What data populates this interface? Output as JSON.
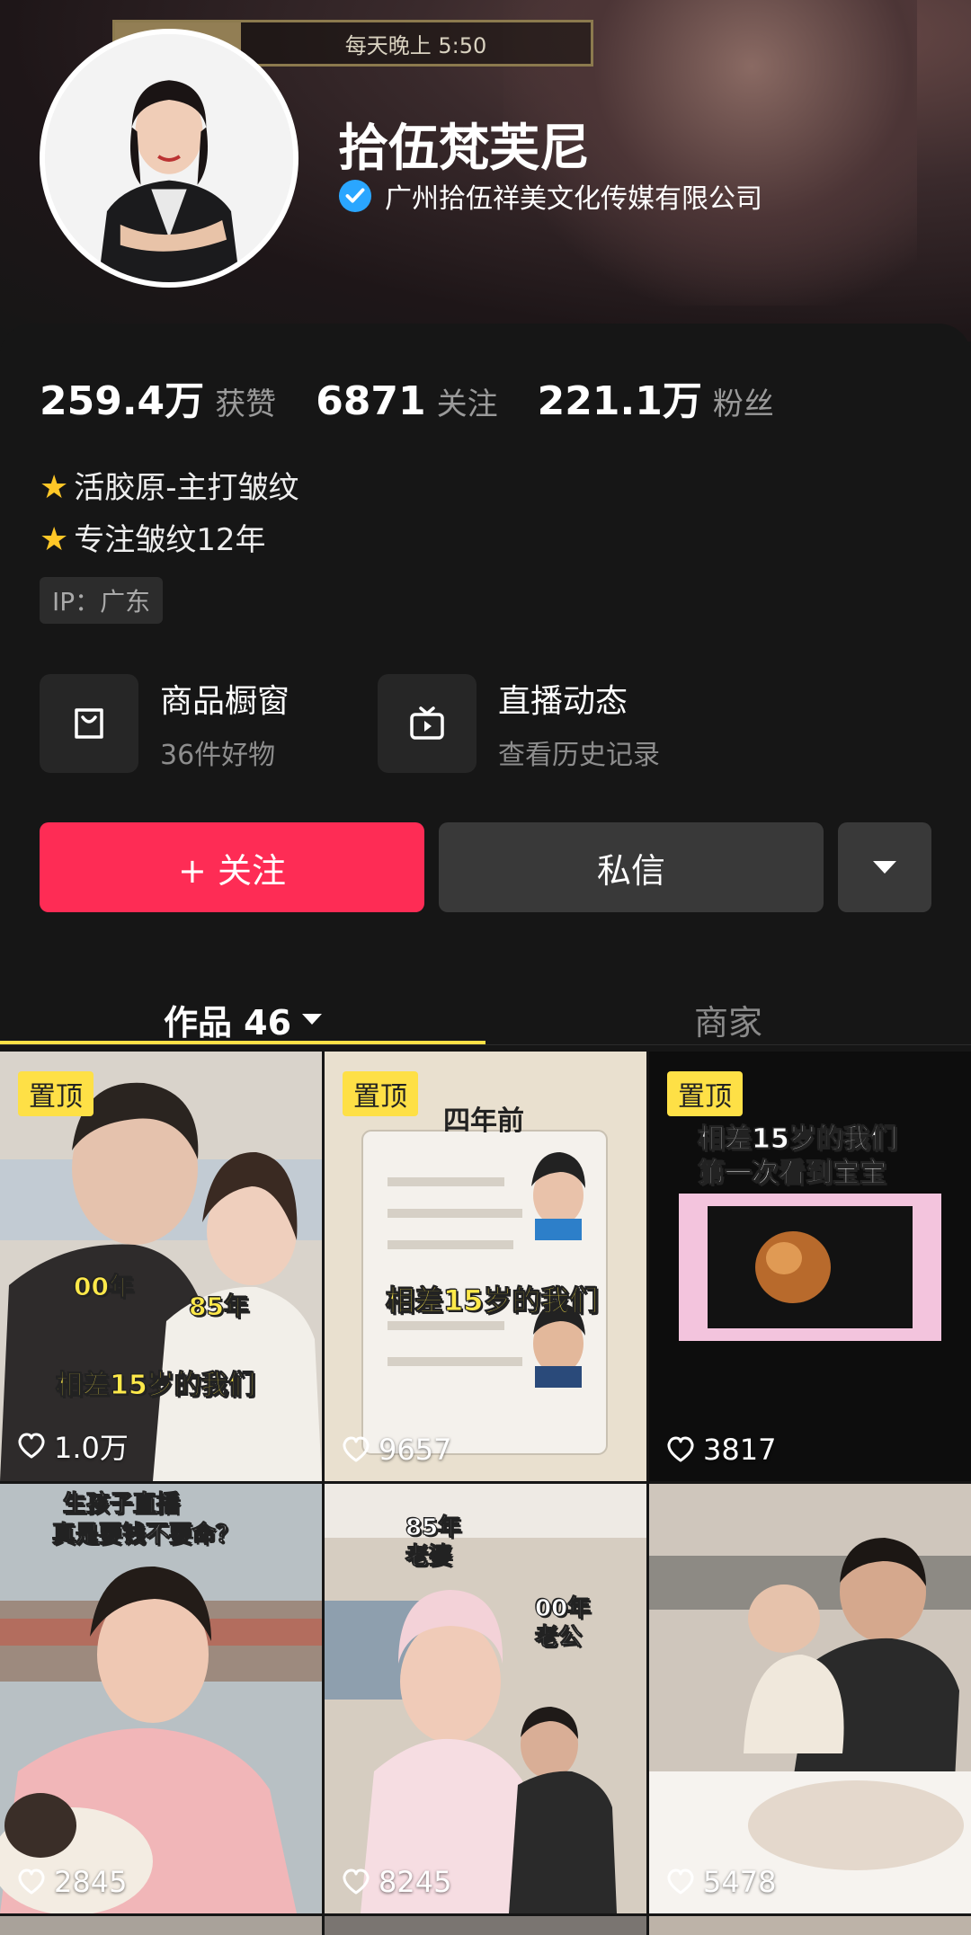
{
  "header": {
    "schedule_text": "每天晚上 5:50",
    "name": "拾伍梵芙尼",
    "verified_org": "广州拾伍祥美文化传媒有限公司"
  },
  "stats": [
    {
      "value": "259.4万",
      "label": "获赞"
    },
    {
      "value": "6871",
      "label": "关注"
    },
    {
      "value": "221.1万",
      "label": "粉丝"
    }
  ],
  "bio": [
    "活胶原-主打皱纹",
    "专注皱纹12年"
  ],
  "ip_tag": "IP：广东",
  "entries": [
    {
      "title": "商品橱窗",
      "sub": "36件好物",
      "icon": "shopping-bag-icon"
    },
    {
      "title": "直播动态",
      "sub": "查看历史记录",
      "icon": "tv-play-icon"
    }
  ],
  "actions": {
    "follow": "+ 关注",
    "message": "私信"
  },
  "tabs": {
    "works": "作品 46",
    "merchant": "商家"
  },
  "videos": [
    {
      "pinned": "置顶",
      "likes": "1.0万",
      "captions": [
        "00年",
        "85年",
        "相差15岁的我们"
      ],
      "bg": "#c9c2b8"
    },
    {
      "pinned": "置顶",
      "likes": "9657",
      "captions": [
        "四年前",
        "相差15岁的我们"
      ],
      "bg": "#e6dac6"
    },
    {
      "pinned": "置顶",
      "likes": "3817",
      "captions": [
        "相差15岁的我们",
        "第一次看到宝宝"
      ],
      "bg": "#0d0d0d"
    },
    {
      "pinned": "",
      "likes": "2845",
      "captions": [
        "生孩子直播",
        "真是要钱不要命？"
      ],
      "bg": "#9aa6ad"
    },
    {
      "pinned": "",
      "likes": "8245",
      "captions": [
        "85年",
        "老婆",
        "00年",
        "老公"
      ],
      "bg": "#cfc4b6"
    },
    {
      "pinned": "",
      "likes": "5478",
      "captions": [],
      "bg": "#c8bfb6"
    }
  ],
  "colors": {
    "accent_red": "#fe2c55",
    "pin_yellow": "#fee046",
    "verify_blue": "#2aa6ff"
  }
}
